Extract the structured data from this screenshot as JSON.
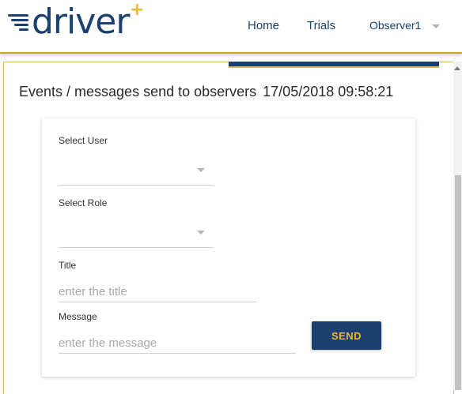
{
  "app": {
    "logo_text": "driver",
    "logo_plus": "+",
    "brand_color": "#1b3f6e",
    "accent_color": "#f2b632"
  },
  "nav": {
    "home": "Home",
    "trials": "Trials",
    "user": "Observer1",
    "user_icon": "chevron-down-icon"
  },
  "page": {
    "title": "Events / messages send to observers",
    "timestamp": "17/05/2018 09:58:21"
  },
  "form": {
    "select_user_label": "Select User",
    "select_user_value": "",
    "select_role_label": "Select Role",
    "select_role_value": "",
    "title_label": "Title",
    "title_placeholder": "enter the title",
    "title_value": "",
    "message_label": "Message",
    "message_placeholder": "enter the message",
    "message_value": "",
    "send_label": "SEND"
  }
}
